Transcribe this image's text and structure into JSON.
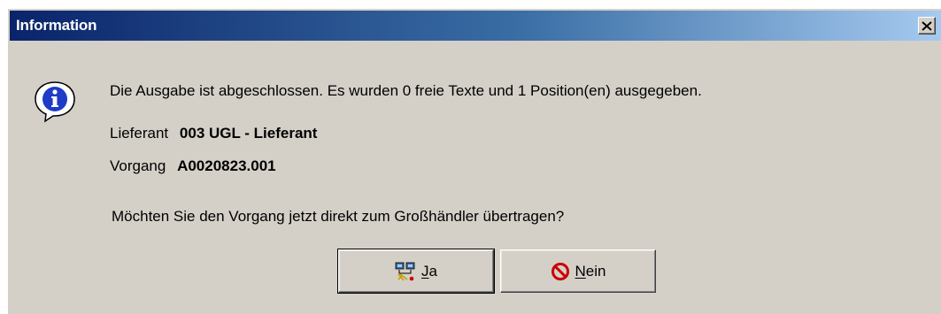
{
  "window": {
    "title": "Information",
    "close_glyph": "✕"
  },
  "message": {
    "main": "Die Ausgabe ist abgeschlossen. Es wurden 0 freie Texte und 1 Position(en) ausgegeben.",
    "question": "Möchten Sie den Vorgang jetzt direkt zum Großhändler übertragen?"
  },
  "details": {
    "lieferant_label": "Lieferant",
    "lieferant_value": "003 UGL - Lieferant",
    "vorgang_label": "Vorgang",
    "vorgang_value": "A0020823.001"
  },
  "buttons": {
    "yes_mnemonic": "J",
    "yes_rest": "a",
    "no_mnemonic": "N",
    "no_rest": "ein"
  },
  "icons": {
    "info": "information-icon",
    "yes": "transfer-icon",
    "no": "prohibited-icon"
  },
  "colors": {
    "title_start": "#0a246a",
    "title_end": "#a6caf0",
    "dialog_bg": "#d4d0c8",
    "no_icon": "#cc0000"
  }
}
